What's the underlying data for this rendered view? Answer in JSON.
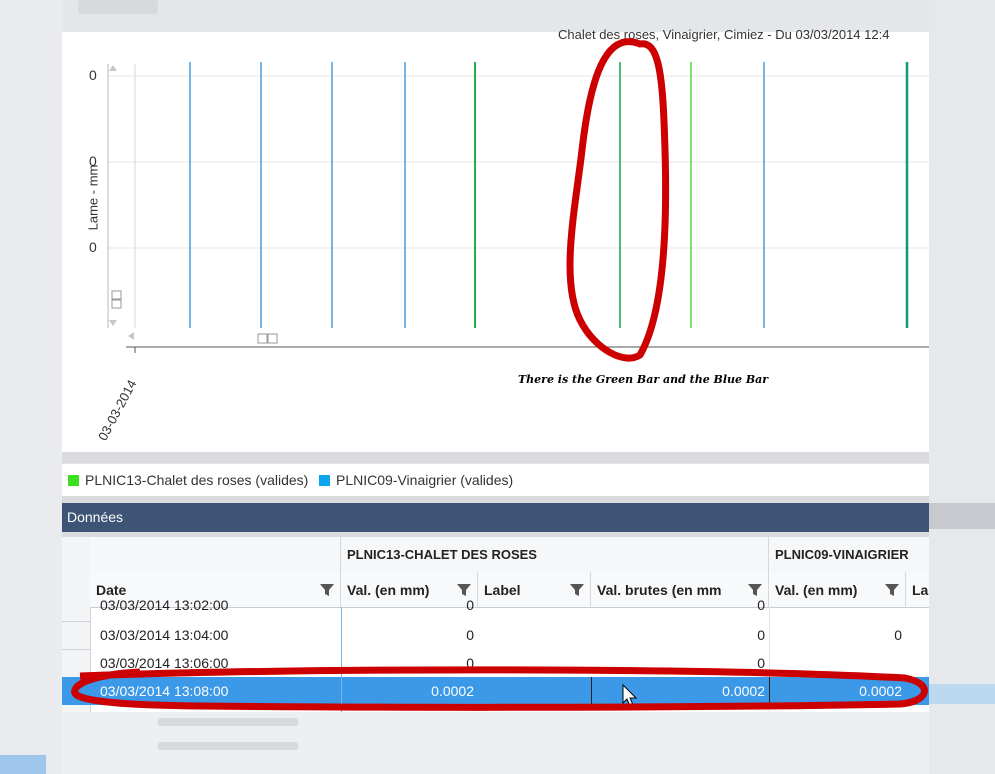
{
  "chart": {
    "title": "Chalet des roses, Vinaigrier, Cimiez - Du 03/03/2014 12:4",
    "ylabel": "Lame - mm",
    "y_ticks": [
      "0",
      "0",
      "0"
    ],
    "x_tick": "03-03-2014",
    "annotation": "There is the Green Bar and the Blue Bar",
    "series_colors": {
      "green": "#1fb04a",
      "lightgreen": "#62d84a",
      "blue": "#2a8fd6",
      "teal": "#179a7a"
    }
  },
  "legend": {
    "items": [
      {
        "label": "PLNIC13-Chalet des roses (valides)",
        "color": "#3ce021"
      },
      {
        "label": "PLNIC09-Vinaigrier (valides)",
        "color": "#0ea5f0"
      }
    ]
  },
  "data_panel": {
    "title": "Données",
    "groups": [
      "PLNIC13-CHALET DES ROSES",
      "PLNIC09-VINAIGRIER"
    ],
    "columns": {
      "date": "Date",
      "val1": "Val. (en mm)",
      "label1": "Label",
      "brutes": "Val. brutes (en mm",
      "val2": "Val. (en mm)",
      "label2": "Lal"
    },
    "rows": [
      {
        "date": "03/03/2014 13:02:00",
        "val1": "0",
        "brutes": "0",
        "val2": ""
      },
      {
        "date": "03/03/2014 13:04:00",
        "val1": "0",
        "brutes": "0",
        "val2": "0"
      },
      {
        "date": "03/03/2014 13:06:00",
        "val1": "0",
        "brutes": "0",
        "val2": ""
      },
      {
        "date": "03/03/2014 13:08:00",
        "val1": "0.0002",
        "brutes": "0.0002",
        "val2": "0.0002"
      }
    ]
  }
}
